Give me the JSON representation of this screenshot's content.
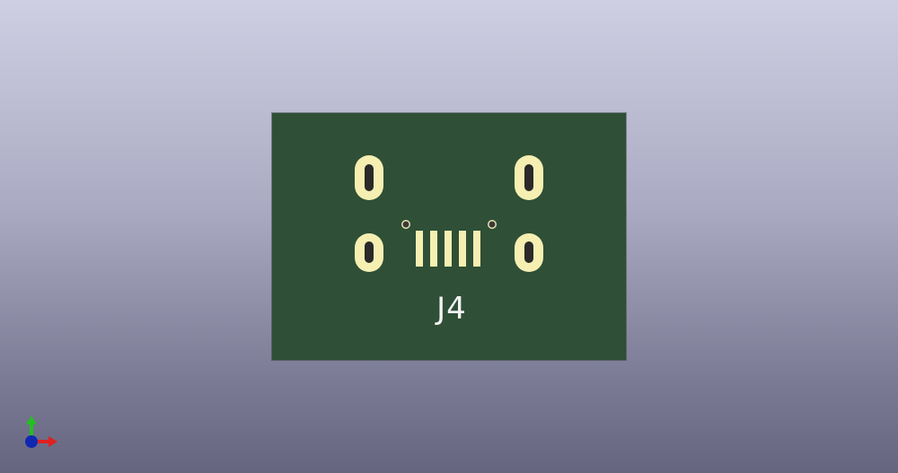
{
  "viewer": {
    "pcb": {
      "reference_designator": "J4",
      "board_color": "#2f4f37",
      "pad_color": "#f6efb2"
    },
    "axis_gizmo": {
      "x_color": "#e02020",
      "y_color": "#22c022",
      "z_color": "#1028b0"
    }
  }
}
